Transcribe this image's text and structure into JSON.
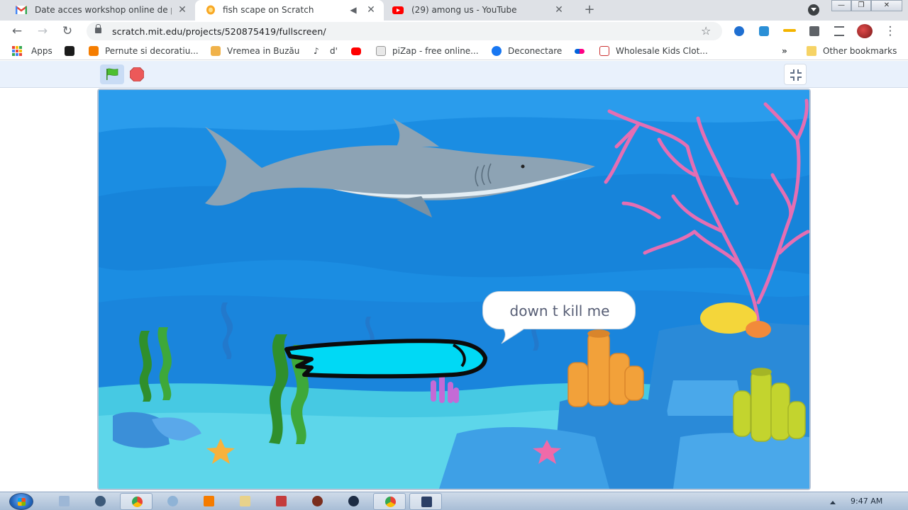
{
  "browser": {
    "tabs": [
      {
        "title": "Date acces workshop online de p",
        "favicon": "gmail-icon",
        "active": false
      },
      {
        "title": "fish scape on Scratch",
        "favicon": "scratch-icon",
        "active": true
      },
      {
        "title": "(29) among us - YouTube",
        "favicon": "youtube-icon",
        "active": false
      }
    ],
    "new_tab": "+",
    "window_controls": {
      "minimize": "—",
      "restore": "❐",
      "close": "✕"
    },
    "url": "scratch.mit.edu/projects/520875419/fullscreen/",
    "bookmarks": [
      {
        "label": "Apps",
        "icon": "apps-grid-icon"
      },
      {
        "label": "",
        "icon": "adobe-icon"
      },
      {
        "label": "Pernute si decoratiu...",
        "icon": "blogger-icon"
      },
      {
        "label": "Vremea in Buzău",
        "icon": "weather-icon"
      },
      {
        "label": "d'",
        "icon": "music-note-icon"
      },
      {
        "label": "",
        "icon": "youtube-icon"
      },
      {
        "label": "piZap - free online...",
        "icon": "pizap-icon"
      },
      {
        "label": "Deconectare",
        "icon": "facebook-icon"
      },
      {
        "label": "",
        "icon": "flickr-icon"
      },
      {
        "label": "Wholesale Kids Clot...",
        "icon": "dh-icon"
      },
      {
        "label": "»",
        "icon": "overflow-icon"
      },
      {
        "label": "Other bookmarks",
        "icon": "folder-icon"
      }
    ]
  },
  "scratch": {
    "speech_bubble": "down t kill me"
  },
  "taskbar": {
    "time": "9:47 AM"
  },
  "colors": {
    "accent_blue": "#1a73e8",
    "water": "#1a8ce0",
    "coral_pink": "#e56eb3",
    "fish_cyan": "#00d9f5"
  }
}
